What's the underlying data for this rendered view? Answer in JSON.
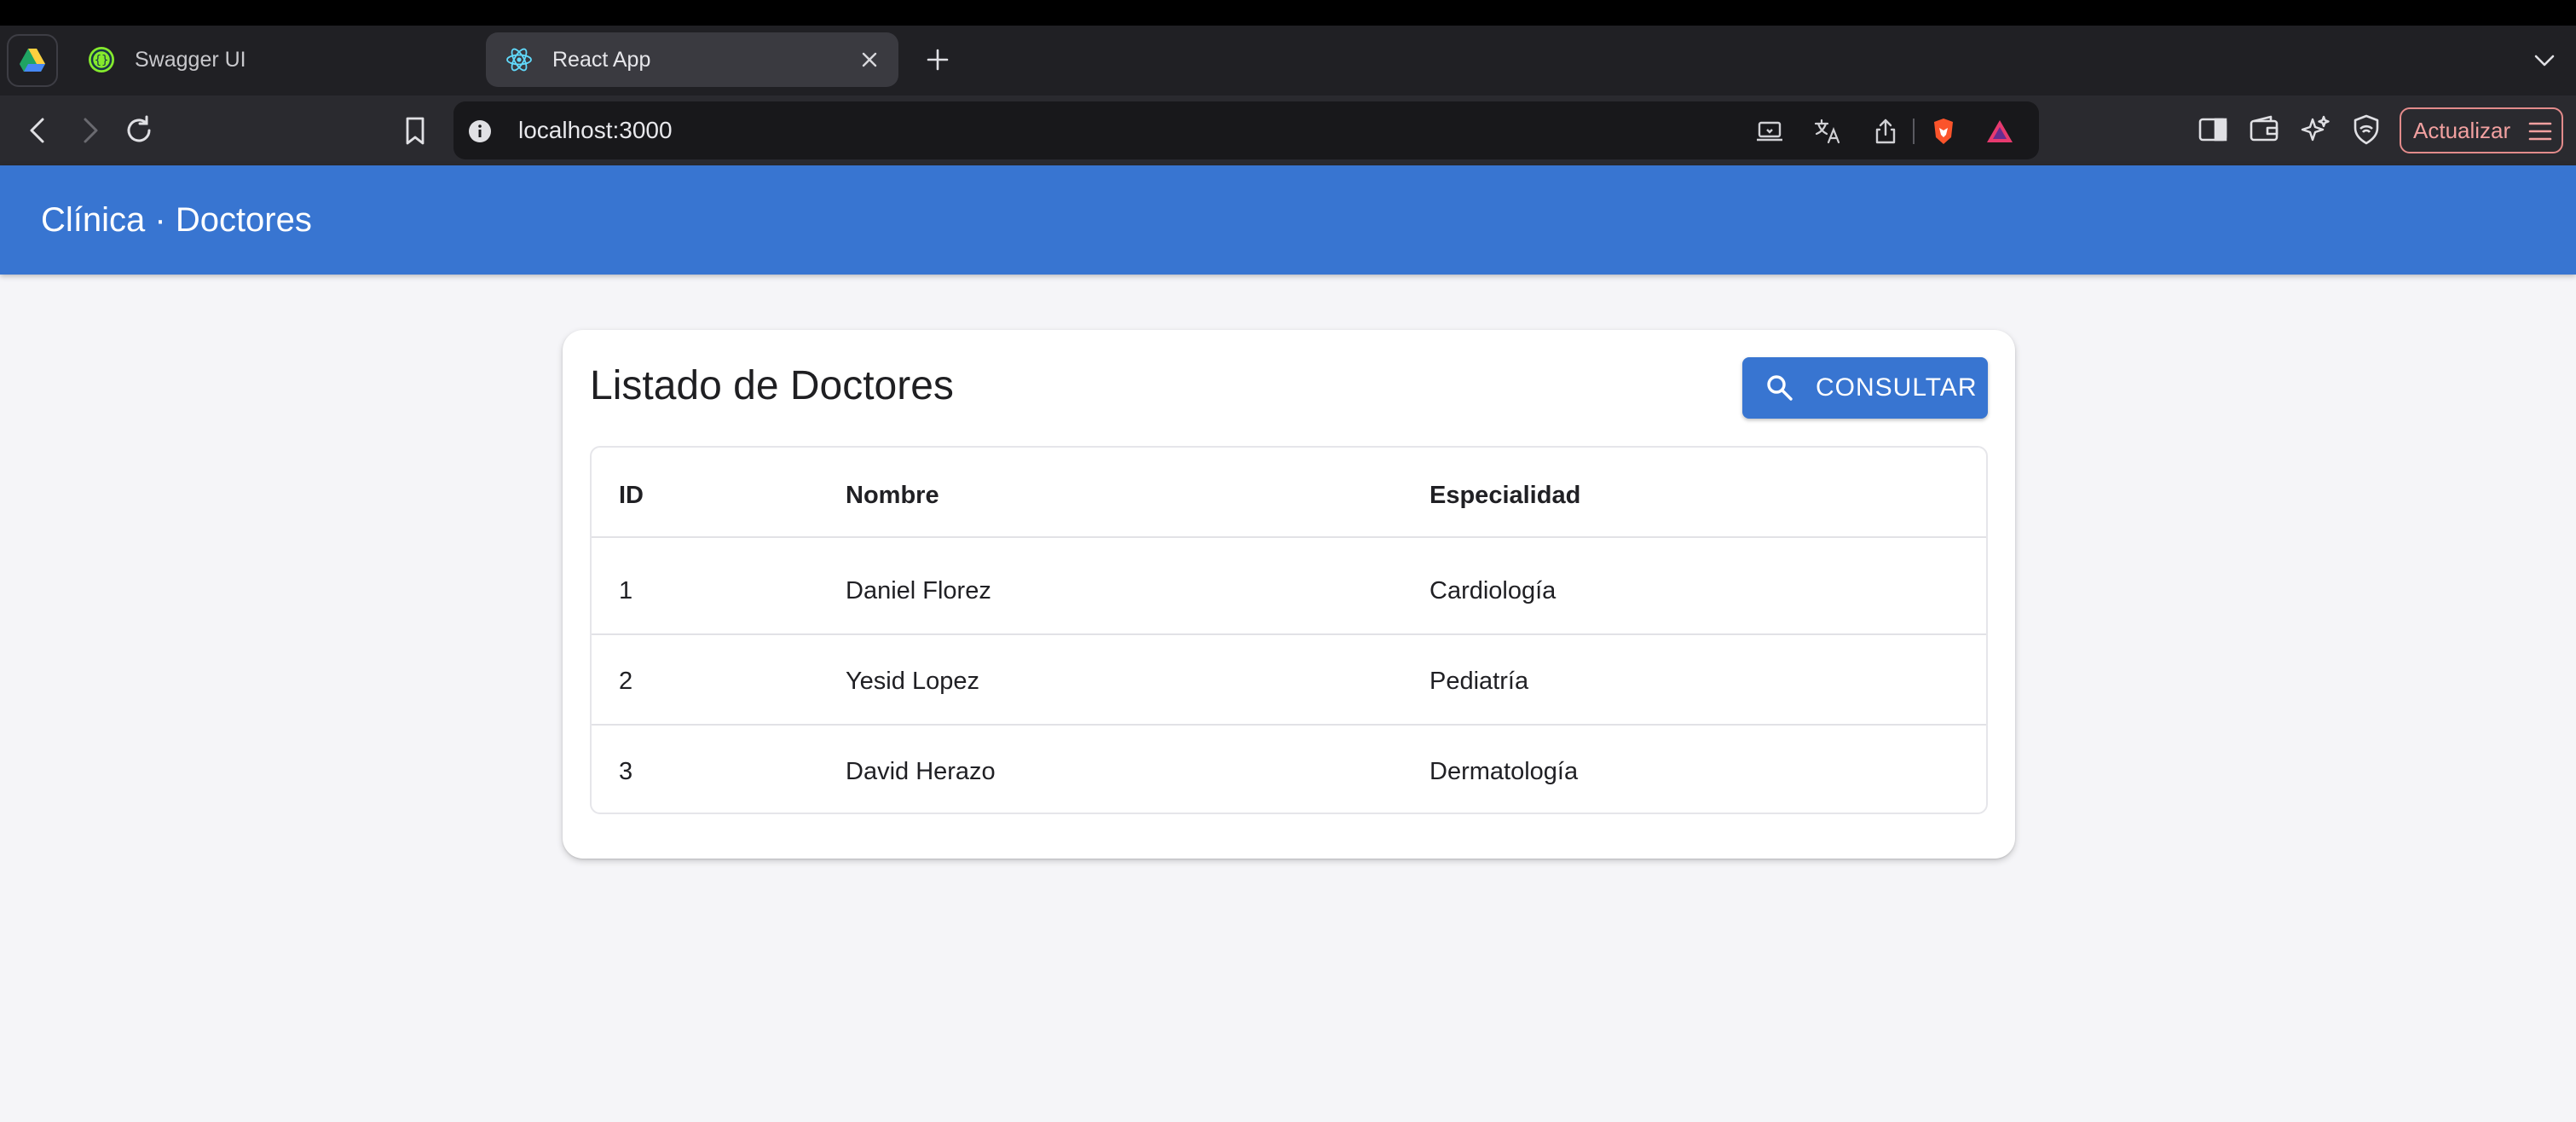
{
  "browser": {
    "tabs": [
      {
        "label": "Swagger UI",
        "active": false,
        "favicon": "swagger-icon"
      },
      {
        "label": "React App",
        "active": true,
        "favicon": "react-icon"
      }
    ],
    "url": "localhost:3000",
    "update_label": "Actualizar"
  },
  "app": {
    "header_title": "Clínica · Doctores",
    "brand_color": "#3875d1"
  },
  "card": {
    "title": "Listado de Doctores",
    "consult_label": "CONSULTAR"
  },
  "table": {
    "columns": [
      "ID",
      "Nombre",
      "Especialidad"
    ],
    "rows": [
      [
        "1",
        "Daniel Florez",
        "Cardiología"
      ],
      [
        "2",
        "Yesid Lopez",
        "Pediatría"
      ],
      [
        "3",
        "David Herazo",
        "Dermatología"
      ]
    ]
  }
}
